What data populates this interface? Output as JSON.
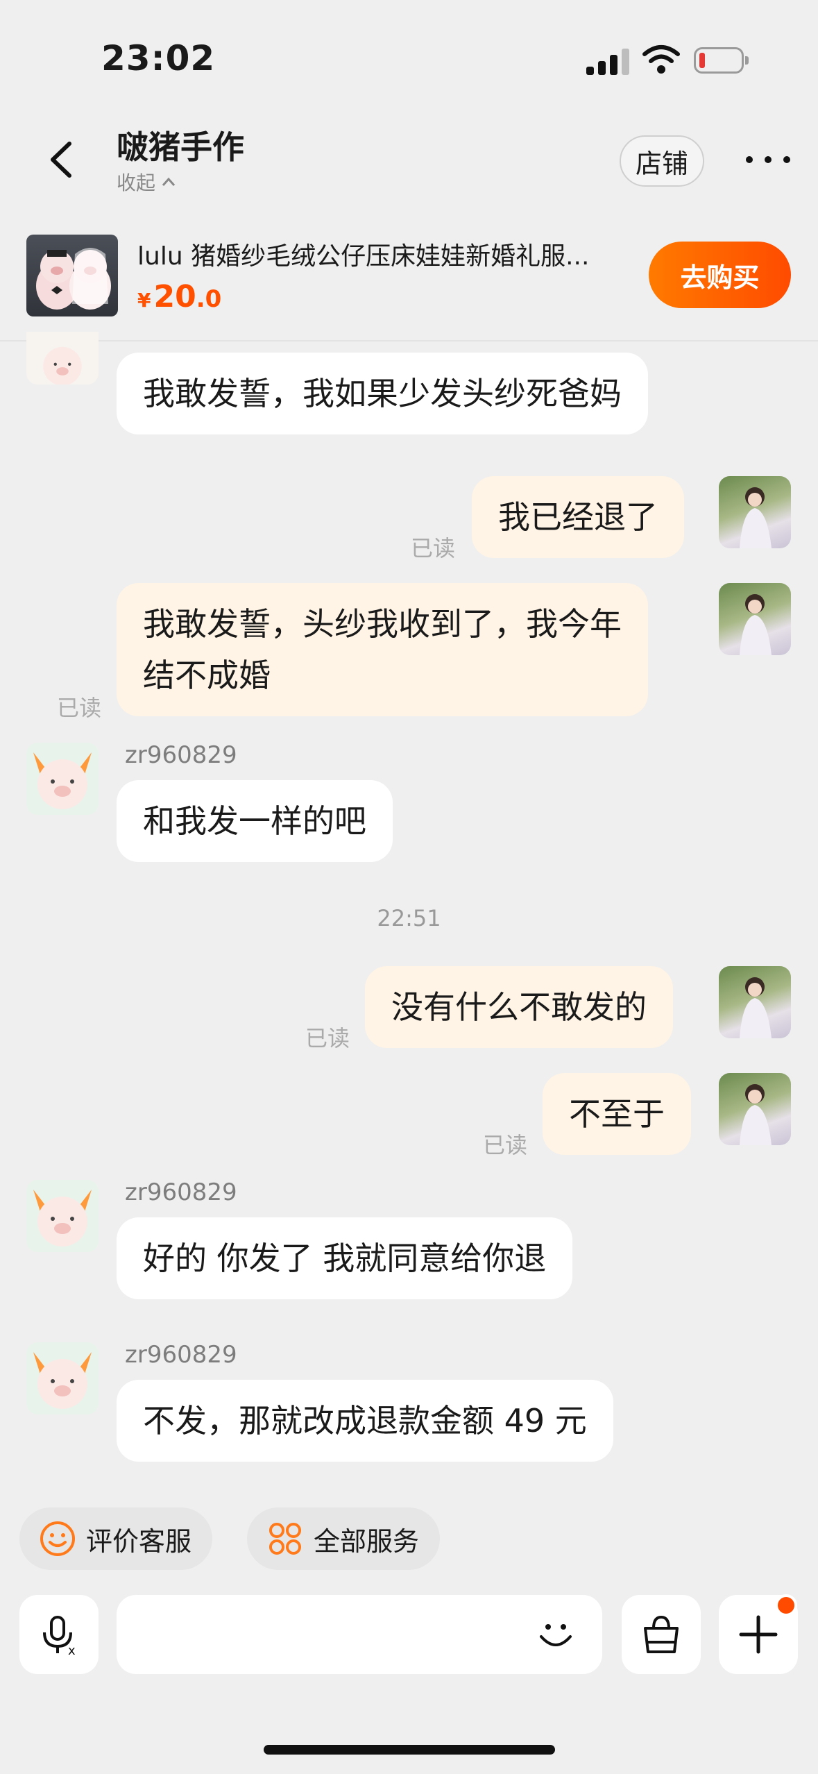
{
  "status_bar": {
    "time": "23:02"
  },
  "header": {
    "shop_name": "啵猪手作",
    "collapse_label": "收起",
    "store_button": "店铺"
  },
  "product": {
    "title": "lulu 猪婚纱毛绒公仔压床娃娃新婚礼服...",
    "price_symbol": "¥",
    "price_int": "20",
    "price_dec": ".0",
    "buy_button": "去购买"
  },
  "messages": [
    {
      "side": "in",
      "text": "我敢发誓，我如果少发头纱死爸妈"
    },
    {
      "side": "out",
      "text": "我已经退了",
      "status": "已读"
    },
    {
      "side": "out",
      "line1": "我敢发誓，头纱我收到了，我今年",
      "line2": "结不成婚",
      "status": "已读"
    },
    {
      "side": "in",
      "sender": "zr960829",
      "text": "和我发一样的吧"
    },
    {
      "type": "time",
      "text": "22:51"
    },
    {
      "side": "out",
      "text": "没有什么不敢发的",
      "status": "已读"
    },
    {
      "side": "out",
      "text": "不至于",
      "status": "已读"
    },
    {
      "side": "in",
      "sender": "zr960829",
      "text": "好的 你发了 我就同意给你退"
    },
    {
      "side": "in",
      "sender": "zr960829",
      "text": "不发，那就改成退款金额 49 元"
    }
  ],
  "quick_actions": [
    {
      "label": "评价客服",
      "icon": "smile-face-icon"
    },
    {
      "label": "全部服务",
      "icon": "services-grid-icon"
    }
  ],
  "input_bar": {
    "voice_icon": "voice-input-icon",
    "emoji_icon": "emoji-icon",
    "bag_icon": "shopping-bag-icon",
    "plus_icon": "plus-icon"
  },
  "colors": {
    "accent": "#ff5000",
    "outgoing_bubble": "#fff4e5",
    "background": "#efefef"
  }
}
